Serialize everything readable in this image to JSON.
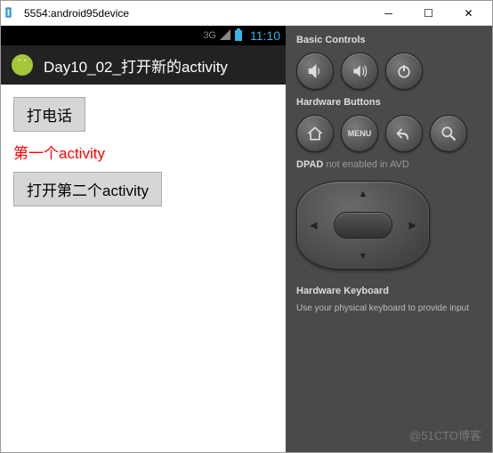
{
  "window": {
    "title": "5554:android95device"
  },
  "statusbar": {
    "network": "3G",
    "time": "11:10"
  },
  "actionbar": {
    "title": "Day10_02_打开新的activity"
  },
  "app": {
    "button_call": "打电话",
    "label_first": "第一个activity",
    "button_open_second": "打开第二个activity"
  },
  "side": {
    "basic_controls": "Basic Controls",
    "hardware_buttons": "Hardware Buttons",
    "menu_label": "MENU",
    "dpad_label": "DPAD",
    "dpad_note": "not enabled in AVD",
    "keyboard_label": "Hardware Keyboard",
    "keyboard_desc": "Use your physical keyboard to provide input"
  },
  "watermark": "@51CTO博客"
}
